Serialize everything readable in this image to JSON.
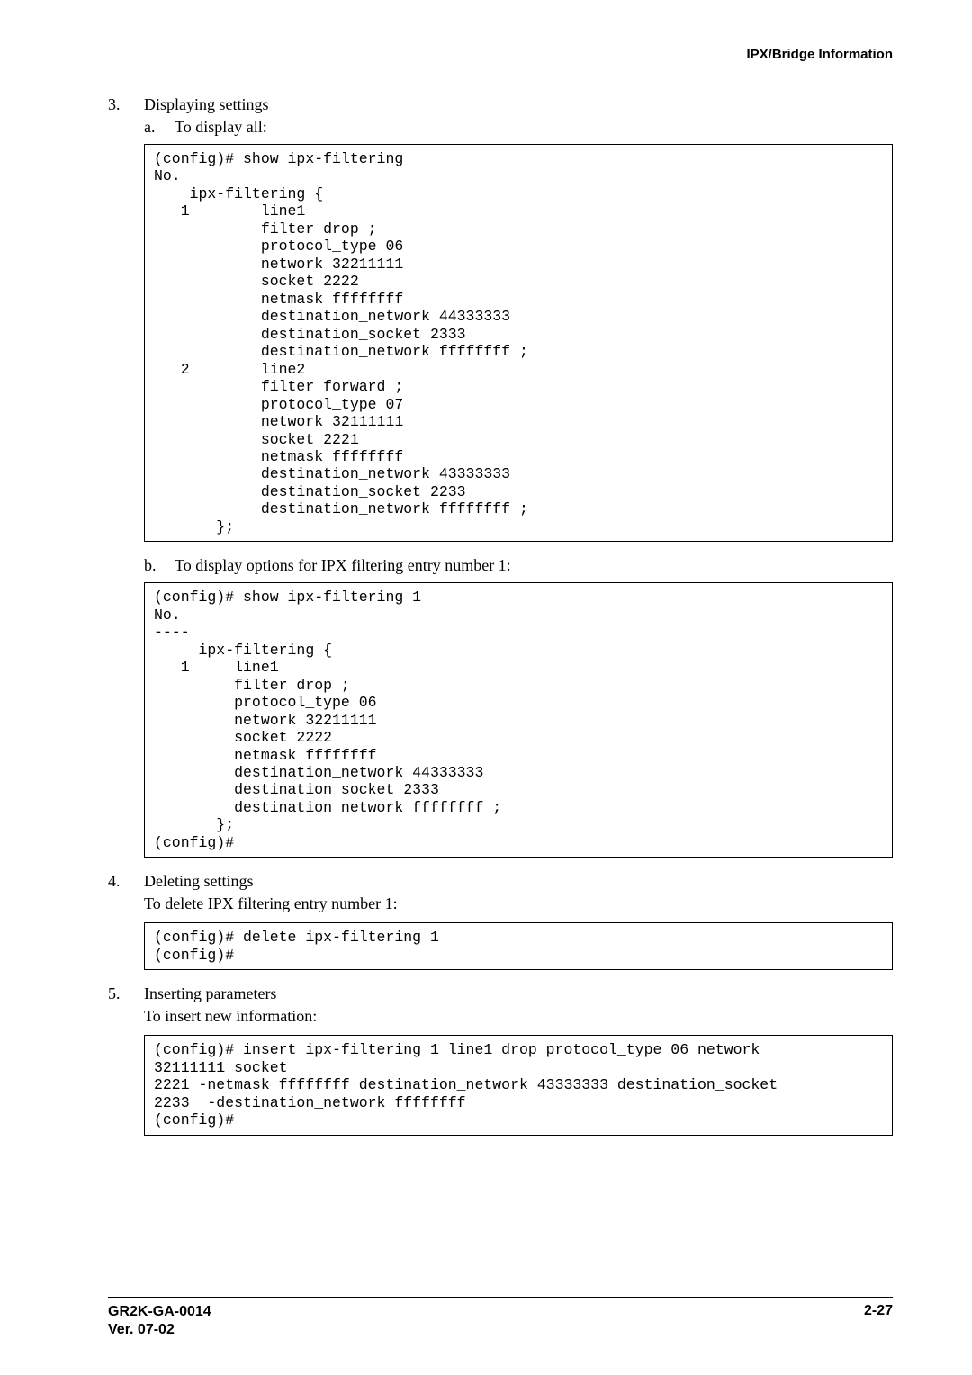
{
  "header": {
    "section": "IPX/Bridge Information"
  },
  "steps": {
    "s3": {
      "num": "3.",
      "label": "Displaying settings",
      "a": {
        "lbl": "a.",
        "txt": "To display all:"
      },
      "codeA": "(config)# show ipx-filtering\nNo.\n    ipx-filtering {\n   1        line1\n            filter drop ;\n            protocol_type 06\n            network 32211111\n            socket 2222\n            netmask ffffffff\n            destination_network 44333333\n            destination_socket 2333\n            destination_network ffffffff ;\n   2        line2\n            filter forward ;\n            protocol_type 07\n            network 32111111\n            socket 2221\n            netmask ffffffff\n            destination_network 43333333\n            destination_socket 2233\n            destination_network ffffffff ;\n       };",
      "b": {
        "lbl": "b.",
        "txt": "To display options for IPX filtering entry number 1:"
      },
      "codeB": "(config)# show ipx-filtering 1\nNo.\n----\n     ipx-filtering {\n   1     line1\n         filter drop ;\n         protocol_type 06\n         network 32211111\n         socket 2222\n         netmask ffffffff\n         destination_network 44333333\n         destination_socket 2333\n         destination_network ffffffff ;\n       };\n(config)#"
    },
    "s4": {
      "num": "4.",
      "label": "Deleting settings",
      "body": "To delete IPX filtering entry number 1:",
      "code": "(config)# delete ipx-filtering 1\n(config)#"
    },
    "s5": {
      "num": "5.",
      "label": "Inserting parameters",
      "body": "To insert new information:",
      "code": "(config)# insert ipx-filtering 1 line1 drop protocol_type 06 network\n32111111 socket\n2221 -netmask ffffffff destination_network 43333333 destination_socket\n2233  -destination_network ffffffff\n(config)#"
    }
  },
  "footer": {
    "doc": "GR2K-GA-0014",
    "ver": "Ver. 07-02",
    "page": "2-27"
  }
}
